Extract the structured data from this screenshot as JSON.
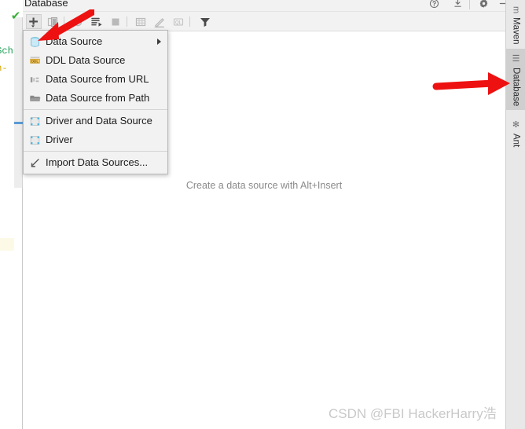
{
  "editor": {
    "code_fragments": [
      "LSch",
      "en-"
    ],
    "gutter_check_icon": "check-mark-icon"
  },
  "tool_window": {
    "title": "Database",
    "header_icons": [
      {
        "name": "help-icon",
        "glyph": "?"
      },
      {
        "name": "collapse-all-icon",
        "glyph": "⤓"
      },
      {
        "name": "settings-gear-icon",
        "glyph": "⚙"
      },
      {
        "name": "hide-window-icon",
        "glyph": "—"
      }
    ],
    "toolbar": [
      {
        "name": "add-new-button",
        "glyph": "+",
        "state": "active"
      },
      {
        "name": "duplicate-datasource-button",
        "glyph": "❐",
        "state": "dim"
      },
      {
        "name": "refresh-button",
        "glyph": "⟳",
        "state": "dim"
      },
      {
        "name": "run-sql-script-button",
        "glyph": "≣",
        "state": "enabled"
      },
      {
        "name": "stop-button",
        "glyph": "■",
        "state": "dim"
      },
      {
        "name": "open-table-editor-button",
        "glyph": "▦",
        "state": "dim"
      },
      {
        "name": "modify-object-button",
        "glyph": "✎",
        "state": "dim"
      },
      {
        "name": "jump-to-query-console-button",
        "glyph": "QL",
        "state": "dim"
      },
      {
        "name": "filter-button",
        "glyph": "▼",
        "state": "enabled"
      }
    ],
    "empty_message": "Create a data source with Alt+Insert"
  },
  "popup_menu": {
    "groups": [
      {
        "items": [
          {
            "label": "Data Source",
            "icon": "database-stack-icon",
            "submenu": true
          },
          {
            "label": "DDL Data Source",
            "icon": "ddl-icon",
            "submenu": false
          },
          {
            "label": "Data Source from URL",
            "icon": "url-icon",
            "submenu": false
          },
          {
            "label": "Data Source from Path",
            "icon": "folder-icon",
            "submenu": false
          }
        ]
      },
      {
        "items": [
          {
            "label": "Driver and Data Source",
            "icon": "driver-icon",
            "submenu": false
          },
          {
            "label": "Driver",
            "icon": "driver-icon",
            "submenu": false
          }
        ]
      },
      {
        "items": [
          {
            "label": "Import Data Sources...",
            "icon": "import-icon",
            "submenu": false
          }
        ]
      }
    ]
  },
  "right_tool_tabs": [
    {
      "label": "Maven",
      "icon": "maven-icon",
      "selected": false
    },
    {
      "label": "Database",
      "icon": "database-icon",
      "selected": true
    },
    {
      "label": "Ant",
      "icon": "ant-icon",
      "selected": false
    }
  ],
  "annotations": {
    "arrow_to_add_button": "red-arrow-icon",
    "arrow_to_database_tab": "red-arrow-icon",
    "arrow_color": "#ee1111"
  },
  "watermark": "CSDN @FBI HackerHarry浩",
  "colors": {
    "panel_bg": "#f2f2f2",
    "content_bg": "#ffffff",
    "tab_selected": "#cfcfcf",
    "accent_red": "#ee1111",
    "check_green": "#3cae3c",
    "watermark_gray": "#c9c9c9"
  }
}
